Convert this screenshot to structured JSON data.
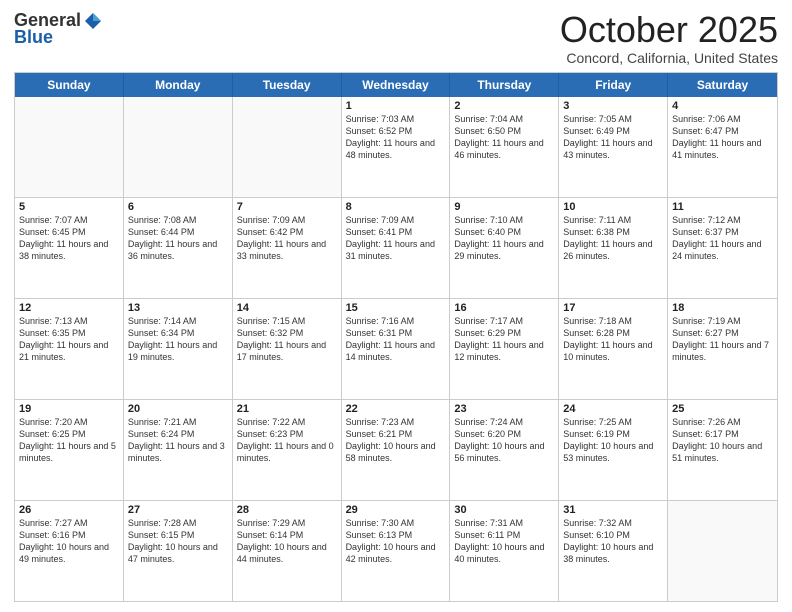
{
  "header": {
    "logo_general": "General",
    "logo_blue": "Blue",
    "month_title": "October 2025",
    "location": "Concord, California, United States"
  },
  "calendar": {
    "days_of_week": [
      "Sunday",
      "Monday",
      "Tuesday",
      "Wednesday",
      "Thursday",
      "Friday",
      "Saturday"
    ],
    "rows": [
      [
        {
          "day": "",
          "info": "",
          "empty": true
        },
        {
          "day": "",
          "info": "",
          "empty": true
        },
        {
          "day": "",
          "info": "",
          "empty": true
        },
        {
          "day": "1",
          "info": "Sunrise: 7:03 AM\nSunset: 6:52 PM\nDaylight: 11 hours\nand 48 minutes."
        },
        {
          "day": "2",
          "info": "Sunrise: 7:04 AM\nSunset: 6:50 PM\nDaylight: 11 hours\nand 46 minutes."
        },
        {
          "day": "3",
          "info": "Sunrise: 7:05 AM\nSunset: 6:49 PM\nDaylight: 11 hours\nand 43 minutes."
        },
        {
          "day": "4",
          "info": "Sunrise: 7:06 AM\nSunset: 6:47 PM\nDaylight: 11 hours\nand 41 minutes."
        }
      ],
      [
        {
          "day": "5",
          "info": "Sunrise: 7:07 AM\nSunset: 6:45 PM\nDaylight: 11 hours\nand 38 minutes."
        },
        {
          "day": "6",
          "info": "Sunrise: 7:08 AM\nSunset: 6:44 PM\nDaylight: 11 hours\nand 36 minutes."
        },
        {
          "day": "7",
          "info": "Sunrise: 7:09 AM\nSunset: 6:42 PM\nDaylight: 11 hours\nand 33 minutes."
        },
        {
          "day": "8",
          "info": "Sunrise: 7:09 AM\nSunset: 6:41 PM\nDaylight: 11 hours\nand 31 minutes."
        },
        {
          "day": "9",
          "info": "Sunrise: 7:10 AM\nSunset: 6:40 PM\nDaylight: 11 hours\nand 29 minutes."
        },
        {
          "day": "10",
          "info": "Sunrise: 7:11 AM\nSunset: 6:38 PM\nDaylight: 11 hours\nand 26 minutes."
        },
        {
          "day": "11",
          "info": "Sunrise: 7:12 AM\nSunset: 6:37 PM\nDaylight: 11 hours\nand 24 minutes."
        }
      ],
      [
        {
          "day": "12",
          "info": "Sunrise: 7:13 AM\nSunset: 6:35 PM\nDaylight: 11 hours\nand 21 minutes."
        },
        {
          "day": "13",
          "info": "Sunrise: 7:14 AM\nSunset: 6:34 PM\nDaylight: 11 hours\nand 19 minutes."
        },
        {
          "day": "14",
          "info": "Sunrise: 7:15 AM\nSunset: 6:32 PM\nDaylight: 11 hours\nand 17 minutes."
        },
        {
          "day": "15",
          "info": "Sunrise: 7:16 AM\nSunset: 6:31 PM\nDaylight: 11 hours\nand 14 minutes."
        },
        {
          "day": "16",
          "info": "Sunrise: 7:17 AM\nSunset: 6:29 PM\nDaylight: 11 hours\nand 12 minutes."
        },
        {
          "day": "17",
          "info": "Sunrise: 7:18 AM\nSunset: 6:28 PM\nDaylight: 11 hours\nand 10 minutes."
        },
        {
          "day": "18",
          "info": "Sunrise: 7:19 AM\nSunset: 6:27 PM\nDaylight: 11 hours\nand 7 minutes."
        }
      ],
      [
        {
          "day": "19",
          "info": "Sunrise: 7:20 AM\nSunset: 6:25 PM\nDaylight: 11 hours\nand 5 minutes."
        },
        {
          "day": "20",
          "info": "Sunrise: 7:21 AM\nSunset: 6:24 PM\nDaylight: 11 hours\nand 3 minutes."
        },
        {
          "day": "21",
          "info": "Sunrise: 7:22 AM\nSunset: 6:23 PM\nDaylight: 11 hours\nand 0 minutes."
        },
        {
          "day": "22",
          "info": "Sunrise: 7:23 AM\nSunset: 6:21 PM\nDaylight: 10 hours\nand 58 minutes."
        },
        {
          "day": "23",
          "info": "Sunrise: 7:24 AM\nSunset: 6:20 PM\nDaylight: 10 hours\nand 56 minutes."
        },
        {
          "day": "24",
          "info": "Sunrise: 7:25 AM\nSunset: 6:19 PM\nDaylight: 10 hours\nand 53 minutes."
        },
        {
          "day": "25",
          "info": "Sunrise: 7:26 AM\nSunset: 6:17 PM\nDaylight: 10 hours\nand 51 minutes."
        }
      ],
      [
        {
          "day": "26",
          "info": "Sunrise: 7:27 AM\nSunset: 6:16 PM\nDaylight: 10 hours\nand 49 minutes."
        },
        {
          "day": "27",
          "info": "Sunrise: 7:28 AM\nSunset: 6:15 PM\nDaylight: 10 hours\nand 47 minutes."
        },
        {
          "day": "28",
          "info": "Sunrise: 7:29 AM\nSunset: 6:14 PM\nDaylight: 10 hours\nand 44 minutes."
        },
        {
          "day": "29",
          "info": "Sunrise: 7:30 AM\nSunset: 6:13 PM\nDaylight: 10 hours\nand 42 minutes."
        },
        {
          "day": "30",
          "info": "Sunrise: 7:31 AM\nSunset: 6:11 PM\nDaylight: 10 hours\nand 40 minutes."
        },
        {
          "day": "31",
          "info": "Sunrise: 7:32 AM\nSunset: 6:10 PM\nDaylight: 10 hours\nand 38 minutes."
        },
        {
          "day": "",
          "info": "",
          "empty": true
        }
      ]
    ]
  }
}
